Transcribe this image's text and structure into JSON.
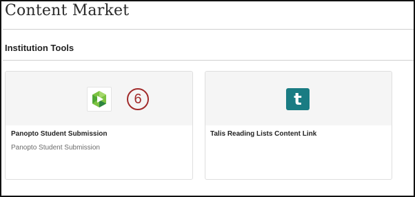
{
  "page": {
    "title": "Content Market"
  },
  "section": {
    "title": "Institution Tools"
  },
  "cards": [
    {
      "title": "Panopto Student Submission",
      "description": "Panopto Student Submission",
      "icon": "panopto-logo-icon",
      "step_badge": "6"
    },
    {
      "title": "Talis Reading Lists Content Link",
      "description": "",
      "icon": "talis-logo-icon",
      "icon_letter": "t"
    }
  ],
  "colors": {
    "panopto_green_light": "#7cc242",
    "panopto_green_dark": "#2e8540",
    "talis_teal": "#1a7c83",
    "badge_red": "#a12a2a",
    "media_background": "#f5f5f5"
  }
}
